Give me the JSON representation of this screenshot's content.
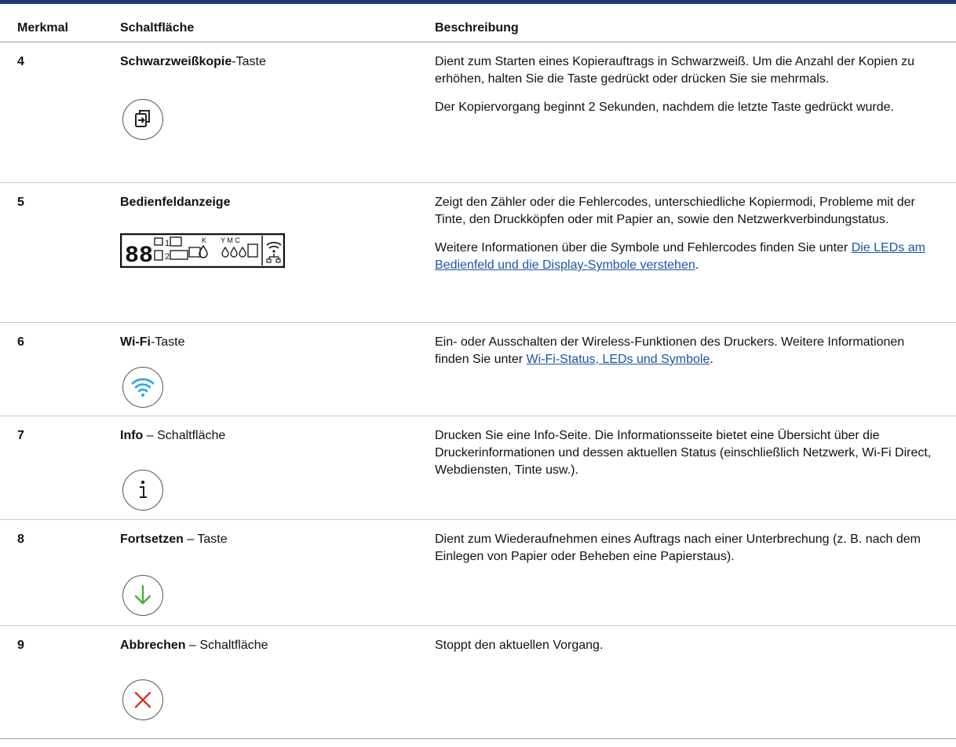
{
  "header": {
    "col1": "Merkmal",
    "col2": "Schaltfläche",
    "col3": "Beschreibung"
  },
  "rows": [
    {
      "num": "4",
      "label_bold": "Schwarzweißkopie",
      "label_rest": "-Taste",
      "icon": "copy-icon",
      "desc": [
        "Dient zum Starten eines Kopierauftrags in Schwarzweiß. Um die Anzahl der Kopien zu erhöhen, halten Sie die Taste gedrückt oder drücken Sie sie mehrmals.",
        "Der Kopiervorgang beginnt 2 Sekunden, nachdem die letzte Taste gedrückt wurde."
      ]
    },
    {
      "num": "5",
      "label_bold": "Bedienfeldanzeige",
      "label_rest": "",
      "icon": "control-panel-display",
      "display_text": {
        "digits": "88",
        "one": "1",
        "two": "2",
        "k": "K",
        "ymc": "Y M C"
      },
      "desc": [
        "Zeigt den Zähler oder die Fehlercodes, unterschiedliche Kopiermodi, Probleme mit der Tinte, den Druckköpfen oder mit Papier an, sowie den Netzwerkverbindungstatus."
      ],
      "desc2_prefix": "Weitere Informationen über die Symbole und Fehlercodes finden Sie unter",
      "desc2_link": "Die LEDs am Bedienfeld und die Display-Symbole verstehen",
      "desc2_suffix": "."
    },
    {
      "num": "6",
      "label_bold": "Wi-Fi",
      "label_rest": "-Taste",
      "icon": "wifi-icon",
      "desc_prefix": "Ein- oder Ausschalten der Wireless-Funktionen des Druckers. Weitere Informationen finden Sie unter",
      "desc_link": "Wi-Fi-Status, LEDs und Symbole",
      "desc_suffix": "."
    },
    {
      "num": "7",
      "label_bold": "Info",
      "label_rest": " – Schaltfläche",
      "icon": "info-icon",
      "desc": [
        "Drucken Sie eine Info-Seite. Die Informationsseite bietet eine Übersicht über die Druckerinformationen und dessen aktuellen Status (einschließlich Netzwerk, Wi-Fi Direct, Webdiensten, Tinte usw.)."
      ]
    },
    {
      "num": "8",
      "label_bold": "Fortsetzen",
      "label_rest": " – Taste",
      "icon": "resume-arrow-icon",
      "desc": [
        "Dient zum Wiederaufnehmen eines Auftrags nach einer Unterbrechung (z. B. nach dem Einlegen von Papier oder Beheben eine Papierstaus)."
      ]
    },
    {
      "num": "9",
      "label_bold": "Abbrechen",
      "label_rest": " – Schaltfläche",
      "icon": "cancel-x-icon",
      "desc": [
        "Stoppt den aktuellen Vorgang."
      ]
    }
  ],
  "colors": {
    "topbar": "#1c3a6e",
    "link": "#1a56a6",
    "wifi": "#2aa5e0",
    "resume": "#4caf3c",
    "cancel": "#e0302a"
  }
}
